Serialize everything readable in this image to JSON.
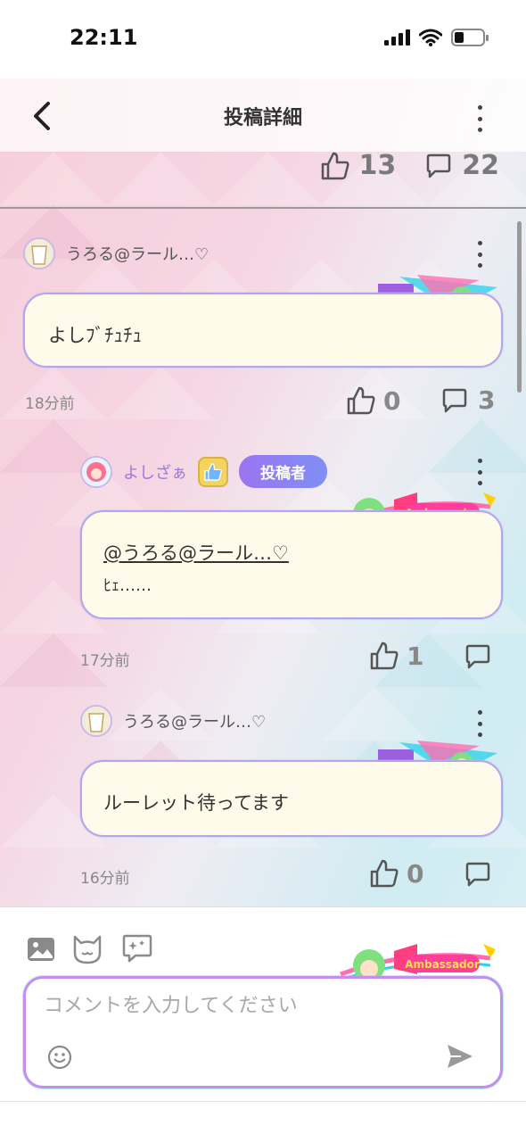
{
  "status": {
    "time": "22:11"
  },
  "header": {
    "title": "投稿詳細",
    "back_icon": "chevron-left-icon",
    "menu_icon": "kebab-icon"
  },
  "post_stats": {
    "likes": "13",
    "comments": "22"
  },
  "comments": [
    {
      "author": "うろる@ラール…♡",
      "text": "よしﾌﾞﾁｭﾁｭ",
      "time": "18分前",
      "likes": "0",
      "replies": "3"
    },
    {
      "author": "よしざぁ",
      "badge": "投稿者",
      "mention": "@うろる@ラール…♡",
      "text": "ﾋｪ……",
      "time": "17分前",
      "likes": "1",
      "deco_label": "Ambassador"
    },
    {
      "author": "うろる@ラール…♡",
      "text": "ルーレット待ってます",
      "time": "16分前",
      "likes": "0"
    }
  ],
  "composer": {
    "placeholder": "コメントを入力してください",
    "deco_label": "Ambassador",
    "tools": [
      "image-icon",
      "cat-face-icon",
      "sparkle-chat-icon"
    ]
  },
  "colors": {
    "accent": "#9b74f0",
    "bubble_bg": "#fffbea",
    "border": "#b9a3ea"
  }
}
